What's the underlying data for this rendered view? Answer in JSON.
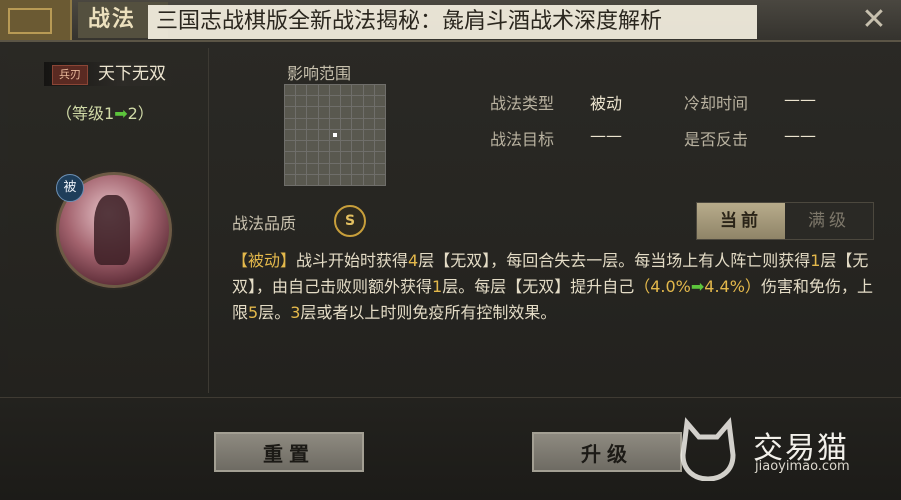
{
  "header": {
    "tab_title": "战法",
    "caption": "三国志战棋版全新战法揭秘：彘肩斗酒战术深度解析",
    "close_glyph": "✕"
  },
  "skill": {
    "type_badge": "兵刃",
    "name": "天下无双",
    "level_text": "（等级1",
    "level_arrow": "➡",
    "level_to": "2）",
    "passive_badge": "被"
  },
  "range": {
    "label": "影响范围",
    "grid_size": 9
  },
  "info": {
    "type_label": "战法类型",
    "type_value": "被动",
    "target_label": "战法目标",
    "target_value": "——",
    "cooldown_label": "冷却时间",
    "cooldown_value": "——",
    "counter_label": "是否反击",
    "counter_value": "——"
  },
  "quality": {
    "label": "战法品质",
    "grade": "S"
  },
  "toggle": {
    "current": "当前",
    "max": "满级"
  },
  "description": {
    "p1": "【被动】",
    "p2": "战斗开始时获得",
    "p3": "4",
    "p4": "层【无双】，每回合失去一层。每当场上有人阵亡则获得",
    "p5": "1",
    "p6": "层【无双】，由自己击败则额外获得",
    "p7": "1",
    "p8": "层。每层【无双】提升自己",
    "p9": "（4.0%",
    "p10": "➡",
    "p11": "4.4%）",
    "p12": "伤害和免伤，上限",
    "p13": "5",
    "p14": "层。",
    "p15": "3",
    "p16": "层或者以上时则免疫所有控制效果。"
  },
  "buttons": {
    "reset": "重置",
    "upgrade": "升级"
  },
  "watermark": {
    "name": "交易猫",
    "url": "jiaoyimao.com"
  }
}
